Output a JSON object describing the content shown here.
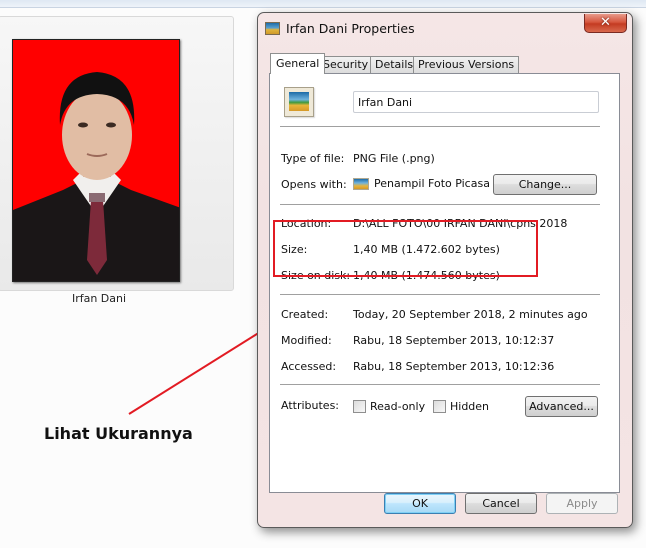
{
  "explorer": {
    "thumbnail_label": "Irfan Dani"
  },
  "annotation": {
    "text": "Lihat Ukurannya",
    "color": "#e21b23"
  },
  "dialog": {
    "title": "Irfan Dani Properties",
    "close_label": "✕",
    "tabs": [
      {
        "label": "General",
        "active": true
      },
      {
        "label": "Security",
        "active": false
      },
      {
        "label": "Details",
        "active": false
      },
      {
        "label": "Previous Versions",
        "active": false
      }
    ],
    "general": {
      "file_name": "Irfan Dani",
      "type_of_file_label": "Type of file:",
      "type_of_file": "PNG File (.png)",
      "opens_with_label": "Opens with:",
      "opens_with": "Penampil Foto Picasa",
      "change_button": "Change...",
      "location_label": "Location:",
      "location": "D:\\ALL FOTO\\00 IRFAN DANI\\cpns 2018",
      "size_label": "Size:",
      "size": "1,40 MB (1.472.602 bytes)",
      "size_on_disk_label": "Size on disk:",
      "size_on_disk": "1,40 MB (1.474.560 bytes)",
      "created_label": "Created:",
      "created": "Today, 20 September 2018, 2 minutes ago",
      "modified_label": "Modified:",
      "modified": "Rabu, 18 September 2013, 10:12:37",
      "accessed_label": "Accessed:",
      "accessed": "Rabu, 18 September 2013, 10:12:36",
      "attributes_label": "Attributes:",
      "readonly_label": "Read-only",
      "readonly_checked": false,
      "hidden_label": "Hidden",
      "hidden_checked": false,
      "advanced_button": "Advanced..."
    },
    "buttons": {
      "ok": "OK",
      "cancel": "Cancel",
      "apply": "Apply"
    }
  }
}
